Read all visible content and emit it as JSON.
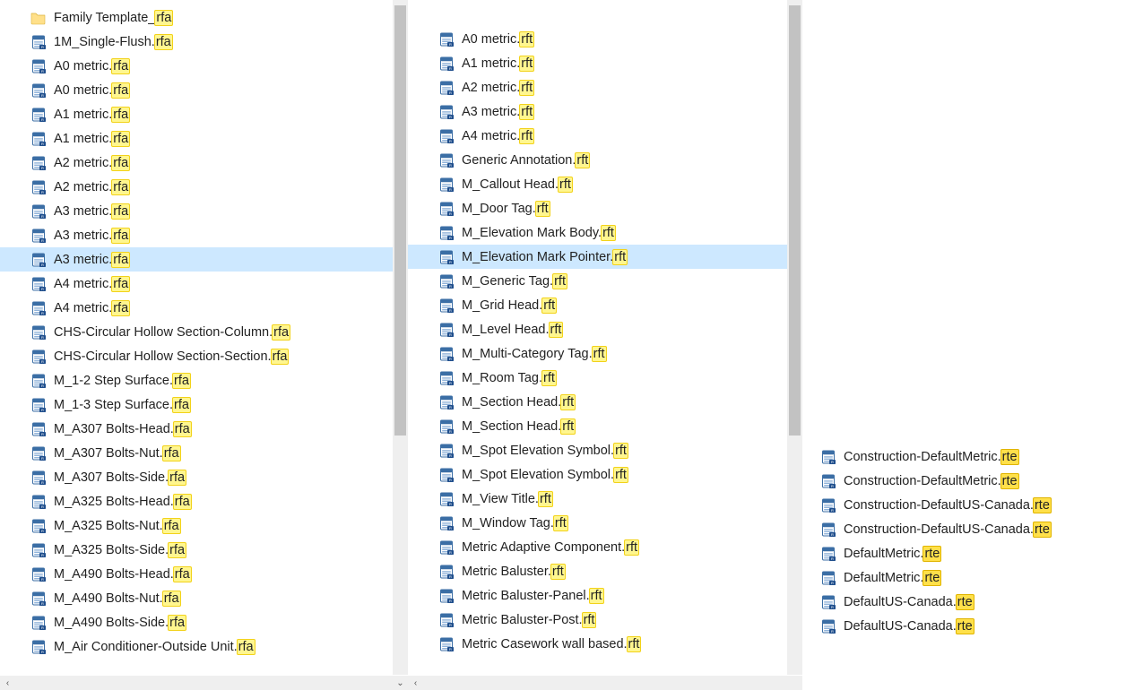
{
  "highlight_ext_class": {
    "rfa": "hl",
    "rft": "hl",
    "rte": "hl strong"
  },
  "pane1": {
    "selected_index": 10,
    "items": [
      {
        "name": "Family Template_",
        "ext": "rfa",
        "icon": "folder"
      },
      {
        "name": "1M_Single-Flush.",
        "ext": "rfa",
        "icon": "file"
      },
      {
        "name": "A0 metric.",
        "ext": "rfa",
        "icon": "file"
      },
      {
        "name": "A0 metric.",
        "ext": "rfa",
        "icon": "file"
      },
      {
        "name": "A1 metric.",
        "ext": "rfa",
        "icon": "file"
      },
      {
        "name": "A1 metric.",
        "ext": "rfa",
        "icon": "file"
      },
      {
        "name": "A2 metric.",
        "ext": "rfa",
        "icon": "file"
      },
      {
        "name": "A2 metric.",
        "ext": "rfa",
        "icon": "file"
      },
      {
        "name": "A3 metric.",
        "ext": "rfa",
        "icon": "file"
      },
      {
        "name": "A3 metric.",
        "ext": "rfa",
        "icon": "file"
      },
      {
        "name": "A3 metric.",
        "ext": "rfa",
        "icon": "file"
      },
      {
        "name": "A4 metric.",
        "ext": "rfa",
        "icon": "file"
      },
      {
        "name": "A4 metric.",
        "ext": "rfa",
        "icon": "file"
      },
      {
        "name": "CHS-Circular Hollow Section-Column.",
        "ext": "rfa",
        "icon": "file"
      },
      {
        "name": "CHS-Circular Hollow Section-Section.",
        "ext": "rfa",
        "icon": "file"
      },
      {
        "name": "M_1-2 Step Surface.",
        "ext": "rfa",
        "icon": "file"
      },
      {
        "name": "M_1-3 Step Surface.",
        "ext": "rfa",
        "icon": "file"
      },
      {
        "name": "M_A307 Bolts-Head.",
        "ext": "rfa",
        "icon": "file"
      },
      {
        "name": "M_A307 Bolts-Nut.",
        "ext": "rfa",
        "icon": "file"
      },
      {
        "name": "M_A307 Bolts-Side.",
        "ext": "rfa",
        "icon": "file"
      },
      {
        "name": "M_A325 Bolts-Head.",
        "ext": "rfa",
        "icon": "file"
      },
      {
        "name": "M_A325 Bolts-Nut.",
        "ext": "rfa",
        "icon": "file"
      },
      {
        "name": "M_A325 Bolts-Side.",
        "ext": "rfa",
        "icon": "file"
      },
      {
        "name": "M_A490 Bolts-Head.",
        "ext": "rfa",
        "icon": "file"
      },
      {
        "name": "M_A490 Bolts-Nut.",
        "ext": "rfa",
        "icon": "file"
      },
      {
        "name": "M_A490 Bolts-Side.",
        "ext": "rfa",
        "icon": "file"
      },
      {
        "name": "M_Air Conditioner-Outside Unit.",
        "ext": "rfa",
        "icon": "file"
      }
    ]
  },
  "pane2": {
    "selected_index": 9,
    "items": [
      {
        "name": "A0 metric.",
        "ext": "rft",
        "icon": "file"
      },
      {
        "name": "A1 metric.",
        "ext": "rft",
        "icon": "file"
      },
      {
        "name": "A2 metric.",
        "ext": "rft",
        "icon": "file"
      },
      {
        "name": "A3 metric.",
        "ext": "rft",
        "icon": "file"
      },
      {
        "name": "A4 metric.",
        "ext": "rft",
        "icon": "file"
      },
      {
        "name": "Generic Annotation.",
        "ext": "rft",
        "icon": "file"
      },
      {
        "name": "M_Callout Head.",
        "ext": "rft",
        "icon": "file"
      },
      {
        "name": "M_Door Tag.",
        "ext": "rft",
        "icon": "file"
      },
      {
        "name": "M_Elevation Mark Body.",
        "ext": "rft",
        "icon": "file"
      },
      {
        "name": "M_Elevation Mark Pointer.",
        "ext": "rft",
        "icon": "file"
      },
      {
        "name": "M_Generic Tag.",
        "ext": "rft",
        "icon": "file"
      },
      {
        "name": "M_Grid Head.",
        "ext": "rft",
        "icon": "file"
      },
      {
        "name": "M_Level Head.",
        "ext": "rft",
        "icon": "file"
      },
      {
        "name": "M_Multi-Category Tag.",
        "ext": "rft",
        "icon": "file"
      },
      {
        "name": "M_Room Tag.",
        "ext": "rft",
        "icon": "file"
      },
      {
        "name": "M_Section Head.",
        "ext": "rft",
        "icon": "file"
      },
      {
        "name": "M_Section Head.",
        "ext": "rft",
        "icon": "file"
      },
      {
        "name": "M_Spot Elevation Symbol.",
        "ext": "rft",
        "icon": "file"
      },
      {
        "name": "M_Spot Elevation Symbol.",
        "ext": "rft",
        "icon": "file"
      },
      {
        "name": "M_View Title.",
        "ext": "rft",
        "icon": "file"
      },
      {
        "name": "M_Window Tag.",
        "ext": "rft",
        "icon": "file"
      },
      {
        "name": "Metric Adaptive Component.",
        "ext": "rft",
        "icon": "file"
      },
      {
        "name": "Metric Baluster.",
        "ext": "rft",
        "icon": "file"
      },
      {
        "name": "Metric Baluster-Panel.",
        "ext": "rft",
        "icon": "file"
      },
      {
        "name": "Metric Baluster-Post.",
        "ext": "rft",
        "icon": "file"
      },
      {
        "name": "Metric Casework wall based.",
        "ext": "rft",
        "icon": "file"
      }
    ]
  },
  "pane3": {
    "selected_index": -1,
    "items": [
      {
        "name": "Construction-DefaultMetric.",
        "ext": "rte",
        "icon": "file"
      },
      {
        "name": "Construction-DefaultMetric.",
        "ext": "rte",
        "icon": "file"
      },
      {
        "name": "Construction-DefaultUS-Canada.",
        "ext": "rte",
        "icon": "file"
      },
      {
        "name": "Construction-DefaultUS-Canada.",
        "ext": "rte",
        "icon": "file"
      },
      {
        "name": "DefaultMetric.",
        "ext": "rte",
        "icon": "file"
      },
      {
        "name": "DefaultMetric.",
        "ext": "rte",
        "icon": "file"
      },
      {
        "name": "DefaultUS-Canada.",
        "ext": "rte",
        "icon": "file"
      },
      {
        "name": "DefaultUS-Canada.",
        "ext": "rte",
        "icon": "file"
      }
    ]
  },
  "scroll": {
    "left_arrow": "‹",
    "right_arrow": "›",
    "down_arrow": "⌄"
  }
}
